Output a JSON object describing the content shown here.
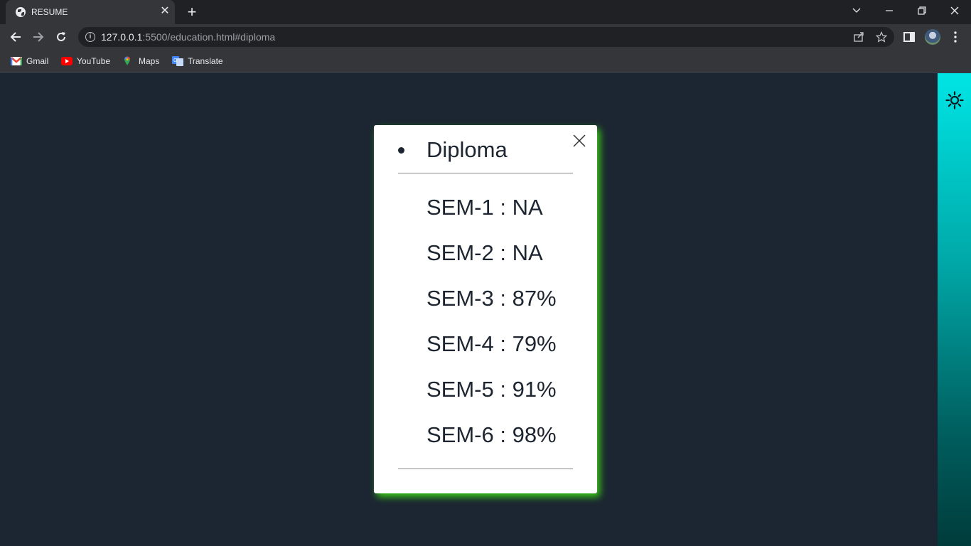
{
  "browser": {
    "tab_title": "RESUME",
    "url_host": "127.0.0.1",
    "url_path": ":5500/education.html#diploma",
    "bookmarks": [
      {
        "label": "Gmail",
        "icon": "gmail-icon"
      },
      {
        "label": "YouTube",
        "icon": "youtube-icon"
      },
      {
        "label": "Maps",
        "icon": "maps-icon"
      },
      {
        "label": "Translate",
        "icon": "translate-icon"
      }
    ]
  },
  "page": {
    "theme_toggle_icon": "sun-icon",
    "accent_color": "#33dd11",
    "strip_gradient": [
      "#00e5e5",
      "#003b3b"
    ]
  },
  "card": {
    "title": "Diploma",
    "close_icon": "close-icon",
    "semesters": [
      "SEM-1 : NA",
      "SEM-2 : NA",
      "SEM-3 : 87%",
      "SEM-4 : 79%",
      "SEM-5 : 91%",
      "SEM-6 : 98%"
    ]
  }
}
